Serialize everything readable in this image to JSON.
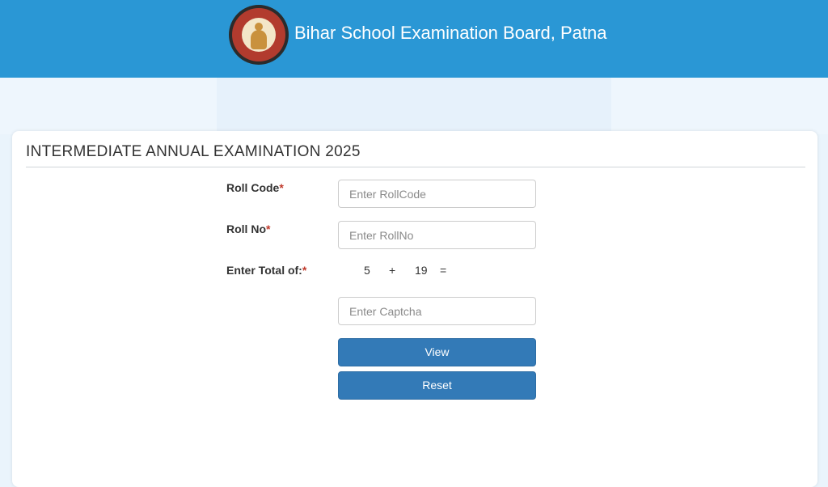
{
  "header": {
    "title": "Bihar School Examination Board, Patna",
    "logo_icon": "bseb-emblem-icon"
  },
  "form": {
    "title": "INTERMEDIATE ANNUAL EXAMINATION 2025",
    "roll_code": {
      "label": "Roll Code",
      "required_mark": "*",
      "placeholder": "Enter RollCode",
      "value": ""
    },
    "roll_no": {
      "label": "Roll No",
      "required_mark": "*",
      "placeholder": "Enter RollNo",
      "value": ""
    },
    "captcha": {
      "label": "Enter Total of:",
      "required_mark": "*",
      "operand1": "5",
      "operator": "+",
      "operand2": "19",
      "equals": "=",
      "placeholder": "Enter Captcha",
      "value": ""
    },
    "view_label": "View",
    "reset_label": "Reset"
  },
  "colors": {
    "header_bg": "#2a97d5",
    "button_bg": "#337ab7",
    "required": "#c0392b"
  }
}
